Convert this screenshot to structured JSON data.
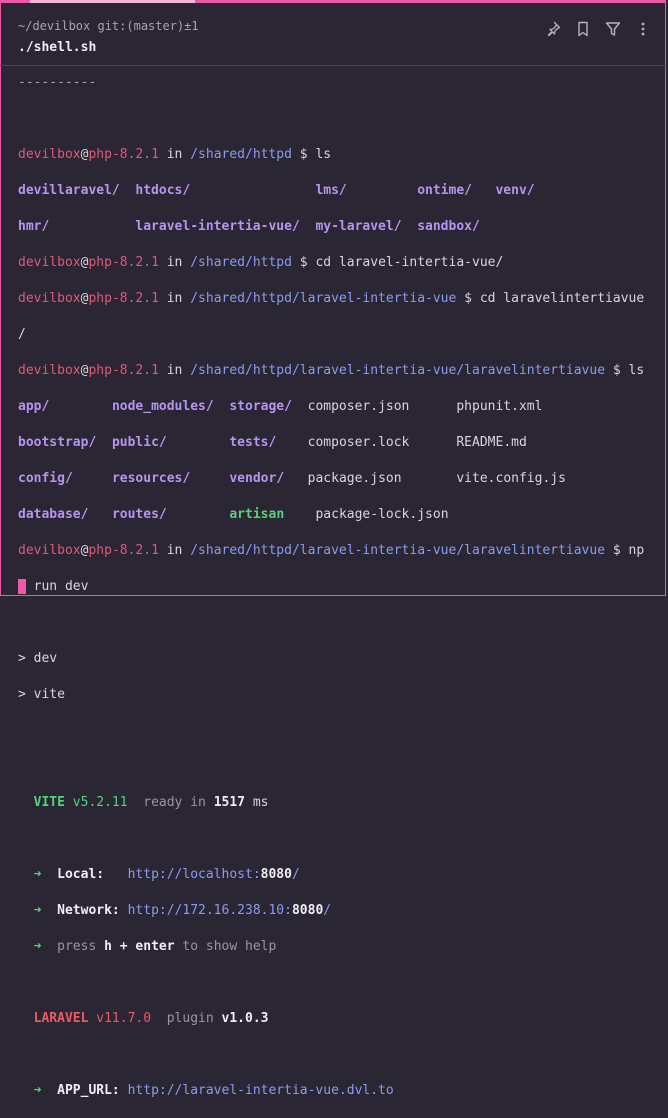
{
  "header": {
    "cwd": "~/devilbox git:(master)±1",
    "command": "./shell.sh"
  },
  "toolbar": {
    "icons": [
      "pin-icon",
      "bookmark-icon",
      "filter-icon",
      "more-icon"
    ]
  },
  "prompt": {
    "user": "devilbox",
    "at": "@",
    "host": "php-8.2.1",
    "in": " in ",
    "sign": " $ "
  },
  "lines": {
    "sep": "----------",
    "p1_path": "/shared/httpd",
    "p1_cmd": "ls",
    "ls1_r1": [
      "devillaravel/",
      "htdocs/",
      "lms/",
      "ontime/",
      "venv/"
    ],
    "ls1_r2": [
      "hmr/",
      "laravel-intertia-vue/",
      "my-laravel/",
      "sandbox/"
    ],
    "p2_path": "/shared/httpd",
    "p2_cmd": "cd laravel-intertia-vue/",
    "p3_path": "/shared/httpd/laravel-intertia-vue",
    "p3_cmd": "cd laravelintertiavue",
    "p3_wrap": "/",
    "p4_path": "/shared/httpd/laravel-intertia-vue/laravelintertiavue",
    "p4_cmd": "ls",
    "ls2": [
      [
        "app/",
        "node_modules/",
        "storage/",
        "composer.json",
        "phpunit.xml"
      ],
      [
        "bootstrap/",
        "public/",
        "tests/",
        "composer.lock",
        "README.md"
      ],
      [
        "config/",
        "resources/",
        "vendor/",
        "package.json",
        "vite.config.js"
      ],
      [
        "database/",
        "routes/",
        "artisan",
        "package-lock.json"
      ]
    ],
    "p5_path": "/shared/httpd/laravel-intertia-vue/laravelintertiavue",
    "p5_cmd": "np",
    "p5_wrap": "m run dev",
    "npm1": "> dev",
    "npm2": "> vite",
    "vite_name": "VITE",
    "vite_ver": "v5.2.11",
    "vite_ready": "ready in",
    "vite_ms": "1517",
    "vite_unit": "ms",
    "arrow": "➜",
    "local_label": "Local:",
    "local_url_a": "http://localhost:",
    "local_port": "8080",
    "local_url_b": "/",
    "net_label": "Network:",
    "net_url_a": "http://172.16.238.10:",
    "net_port": "8080",
    "net_url_b": "/",
    "help_a": "press",
    "help_h": "h + enter",
    "help_b": "to show help",
    "laravel_name": "LARAVEL",
    "laravel_ver": "v11.7.0",
    "plugin_label": "plugin",
    "plugin_ver": "v1.0.3",
    "app_url_label": "APP_URL:",
    "app_url": "http://laravel-intertia-vue.dvl.to"
  }
}
